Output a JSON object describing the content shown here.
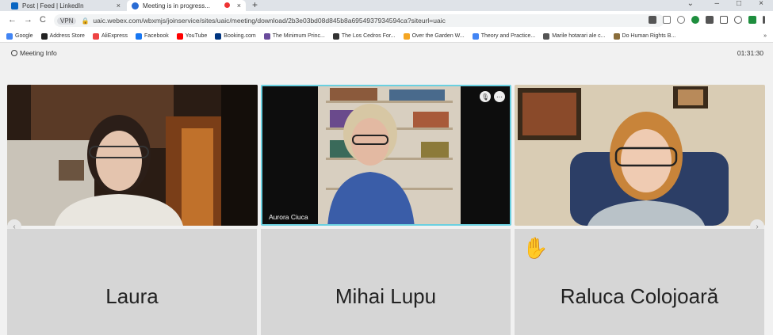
{
  "browser": {
    "tabs": [
      {
        "label": "Post | Feed | LinkedIn",
        "active": false
      },
      {
        "label": "Meeting is in progress...",
        "active": true
      }
    ],
    "new_tab_label": "+",
    "tab_close_glyph": "×",
    "window_controls": {
      "minimize": "–",
      "maximize": "□",
      "close": "×",
      "collapse": "⌄"
    },
    "nav": {
      "back": "←",
      "forward": "→",
      "reload": "C"
    },
    "url_badge": "VPN",
    "url": "uaic.webex.com/wbxmjs/joinservice/sites/uaic/meeting/download/2b3e03bd08d845b8a6954937934594ca?siteurl=uaic",
    "bookmarks": [
      {
        "label": "Google",
        "color": "#4285f4"
      },
      {
        "label": "Address Store",
        "color": "#222222"
      },
      {
        "label": "AliExpress",
        "color": "#e44"
      },
      {
        "label": "Facebook",
        "color": "#1877f2"
      },
      {
        "label": "YouTube",
        "color": "#f00"
      },
      {
        "label": "Booking.com",
        "color": "#003580"
      },
      {
        "label": "The Minimum Princ...",
        "color": "#6a4c9c"
      },
      {
        "label": "The Los Cedros For...",
        "color": "#333333"
      },
      {
        "label": "Over the Garden W...",
        "color": "#f5a623"
      },
      {
        "label": "Theory and Practice...",
        "color": "#4285f4"
      },
      {
        "label": "Marile hotarari ale c...",
        "color": "#555555"
      },
      {
        "label": "Do Human Rights B...",
        "color": "#8a6d3b"
      }
    ],
    "bookmarks_more": "»"
  },
  "meeting": {
    "info_label": "Meeting Info",
    "timer": "01:31:30",
    "active_speaker_label": "Aurora Ciuca",
    "participants": [
      {
        "name": "Laura"
      },
      {
        "name": "Mihai Lupu"
      },
      {
        "name": "Raluca Colojoară"
      }
    ],
    "prev_arrow": "‹",
    "next_arrow": "›",
    "raised_hand": "✋"
  }
}
